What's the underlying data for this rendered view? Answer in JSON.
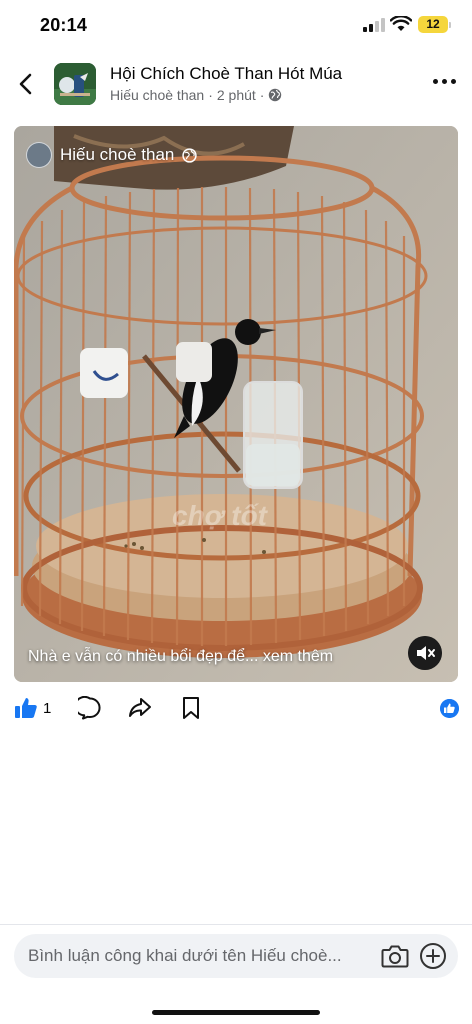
{
  "status_bar": {
    "time": "20:14",
    "battery": "12",
    "battery_color": "#f5d63c"
  },
  "header": {
    "group_name": "Hội Chích Choè Than Hót Múa",
    "author": "Hiếu choè than",
    "separator": "·",
    "time_ago": "2 phút",
    "icons": {
      "back": "chevron-left-icon",
      "privacy": "globe-icon",
      "more": "more-dots-icon"
    }
  },
  "video": {
    "author": "Hiếu choè than",
    "watermark": "chợ tốt",
    "caption": "Nhà e vẫn có nhiều bổi đẹp để...",
    "see_more": "xem thêm",
    "icons": {
      "mute": "volume-muted-icon",
      "privacy": "globe-icon"
    }
  },
  "actions": {
    "like_count": "1",
    "icons": {
      "like": "thumbs-up-icon",
      "comment": "comment-bubble-icon",
      "share": "share-arrow-icon",
      "save": "bookmark-icon",
      "reaction": "like-reaction-icon"
    },
    "accent_color": "#1877f2"
  },
  "comment_bar": {
    "placeholder": "Bình luận công khai dưới tên Hiếu choè...",
    "icons": {
      "camera": "camera-icon",
      "add": "plus-circle-icon"
    }
  }
}
